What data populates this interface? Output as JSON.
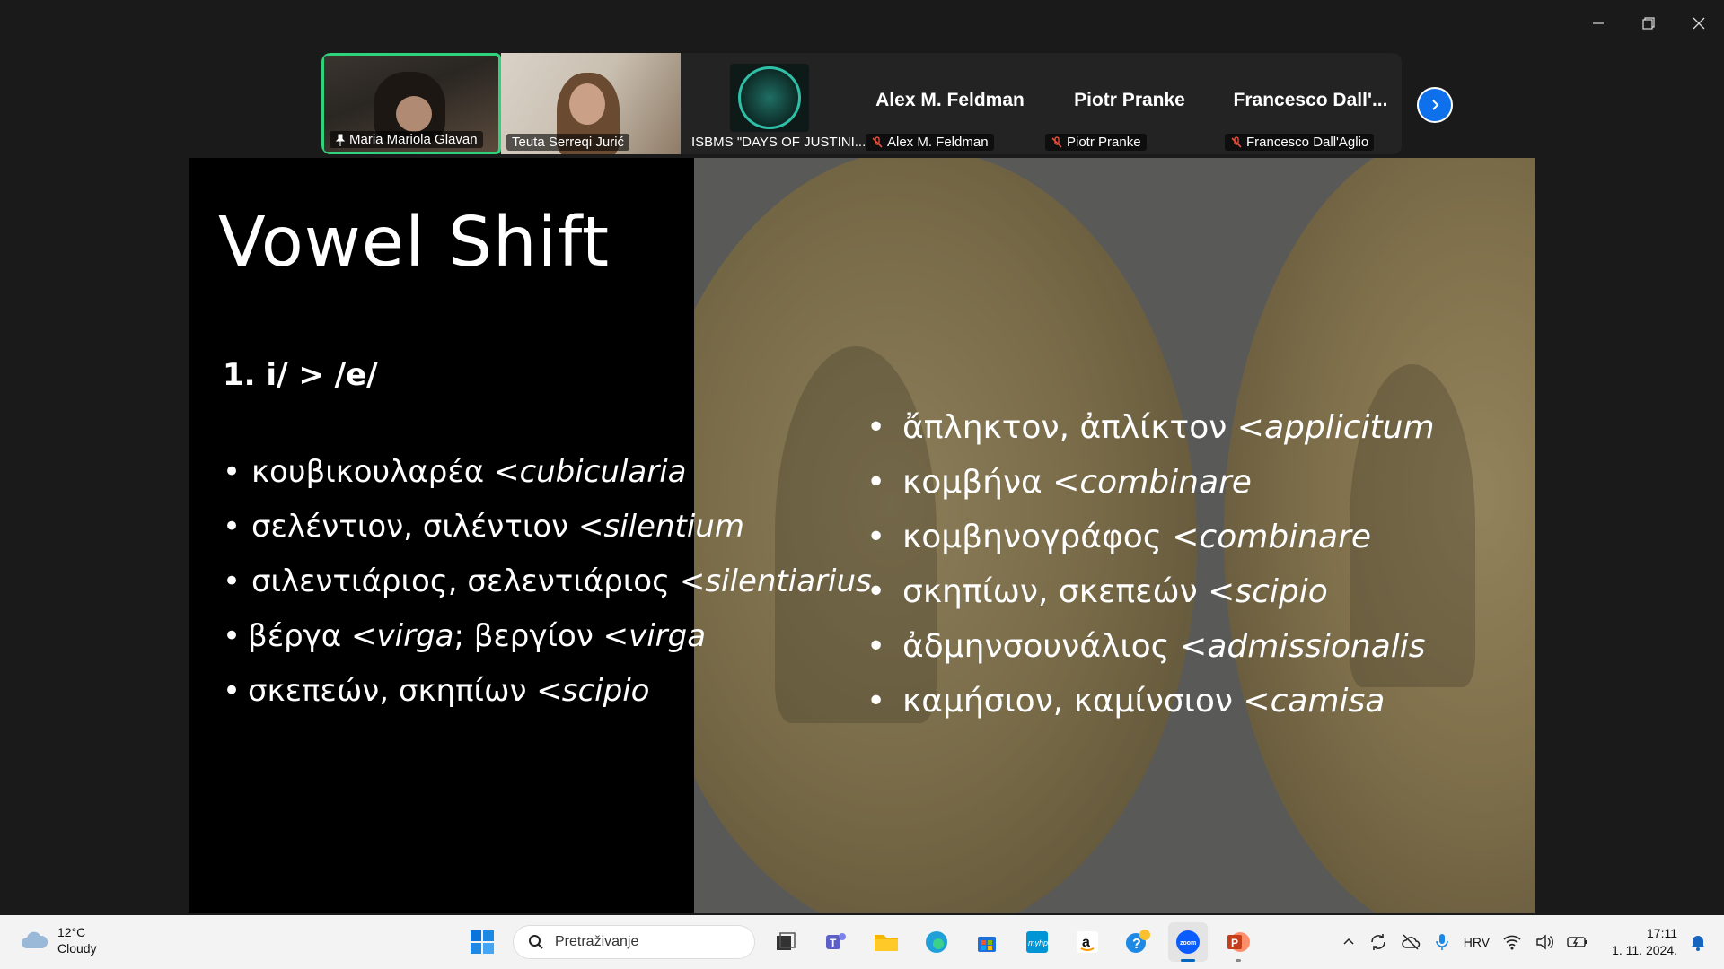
{
  "window": {
    "controls": [
      "minimize",
      "restore",
      "close"
    ]
  },
  "participants": [
    {
      "name": "Maria Mariola Glavan",
      "kind": "video",
      "active": true,
      "pinned": true
    },
    {
      "name": "Teuta Serreqi Jurić",
      "kind": "video",
      "active": false
    },
    {
      "name": "ISBMS \"DAYS OF JUSTINI...",
      "kind": "logo",
      "active": false
    },
    {
      "name": "Alex M. Feldman",
      "display": "Alex M. Feldman",
      "kind": "nameonly",
      "muted": true
    },
    {
      "name": "Piotr Pranke",
      "display": "Piotr Pranke",
      "kind": "nameonly",
      "muted": true
    },
    {
      "name": "Francesco Dall'Aglio",
      "display": "Francesco  Dall'...",
      "kind": "nameonly",
      "muted": true
    }
  ],
  "slide": {
    "title": "Vowel Shift",
    "subhead": "1. i/ > /e/",
    "left_items": [
      {
        "greek": "κουβικουλαρέα < ",
        "latin": "cubicularia",
        "tail": ""
      },
      {
        "greek": "σελέντιον, σιλέντιον < ",
        "latin": "silentium",
        "tail": ""
      },
      {
        "greek": "σιλεντιάριος, σελεντιάριος < ",
        "latin": "silentiarius",
        "tail": ""
      },
      {
        "greek": "βέργα < ",
        "latin": "virga",
        "tail": "; βεργίον < ",
        "latin2": "virga"
      },
      {
        "greek": "σκεπεών, σκηπίων < ",
        "latin": "scipio",
        "tail": ""
      }
    ],
    "right_items": [
      {
        "greek": "ἄπληκτον, ἀπλίκτον < ",
        "latin": "applicitum"
      },
      {
        "greek": "κομβήνα < ",
        "latin": "combinare"
      },
      {
        "greek": "κομβηνογράφος < ",
        "latin": "combinare"
      },
      {
        "greek": "σκηπίων, σκεπεών < ",
        "latin": "scipio"
      },
      {
        "greek": "ἀδμηνσουνάλιος < ",
        "latin": "admissionalis"
      },
      {
        "greek": "καμήσιον, καμίνσιον < ",
        "latin": "camisa"
      }
    ]
  },
  "taskbar": {
    "weather": {
      "temp": "12°C",
      "condition": "Cloudy"
    },
    "search_placeholder": "Pretraživanje",
    "apps": [
      "windows-start",
      "task-view",
      "teams",
      "file-explorer",
      "edge",
      "microsoft-store",
      "myhp",
      "amazon",
      "get-help",
      "zoom",
      "powerpoint"
    ],
    "tray": {
      "language": "HRV",
      "time": "17:11",
      "date": "1. 11. 2024."
    }
  },
  "colors": {
    "active_tile_border": "#2ed37b",
    "zoom_blue": "#0e71eb",
    "taskbar_bg": "#f3f3f3"
  }
}
